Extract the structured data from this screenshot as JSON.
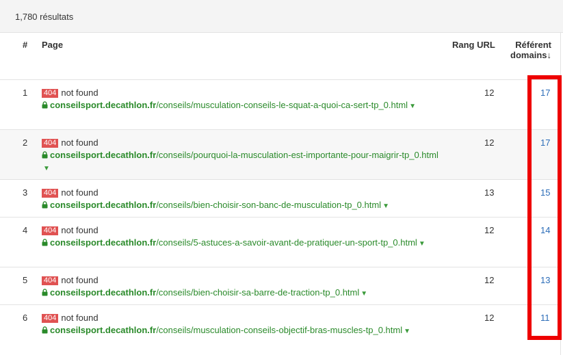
{
  "results": {
    "count_label": "1,780 résultats"
  },
  "table": {
    "headers": {
      "num": "#",
      "page": "Page",
      "rank": "Rang URL",
      "ref_line1": "Référent",
      "ref_line2": "domains",
      "sort_arrow": "↓"
    },
    "rows": [
      {
        "num": "1",
        "status_code": "404",
        "status_text": "not found",
        "domain": "conseilsport.decathlon.fr",
        "path": "/conseils/musculation-conseils-le-squat-a-quoi-ca-sert-tp_0.html",
        "rank": "12",
        "ref": "17"
      },
      {
        "num": "2",
        "status_code": "404",
        "status_text": "not found",
        "domain": "conseilsport.decathlon.fr",
        "path": "/conseils/pourquoi-la-musculation-est-importante-pour-maigrir-tp_0.html",
        "rank": "12",
        "ref": "17"
      },
      {
        "num": "3",
        "status_code": "404",
        "status_text": "not found",
        "domain": "conseilsport.decathlon.fr",
        "path": "/conseils/bien-choisir-son-banc-de-musculation-tp_0.html",
        "rank": "13",
        "ref": "15"
      },
      {
        "num": "4",
        "status_code": "404",
        "status_text": "not found",
        "domain": "conseilsport.decathlon.fr",
        "path": "/conseils/5-astuces-a-savoir-avant-de-pratiquer-un-sport-tp_0.html",
        "rank": "12",
        "ref": "14"
      },
      {
        "num": "5",
        "status_code": "404",
        "status_text": "not found",
        "domain": "conseilsport.decathlon.fr",
        "path": "/conseils/bien-choisir-sa-barre-de-traction-tp_0.html",
        "rank": "12",
        "ref": "13"
      },
      {
        "num": "6",
        "status_code": "404",
        "status_text": "not found",
        "domain": "conseilsport.decathlon.fr",
        "path": "/conseils/musculation-conseils-objectif-bras-muscles-tp_0.html",
        "rank": "12",
        "ref": "11"
      }
    ]
  },
  "icons": {
    "lock": "lock-icon",
    "dropdown": "caret-down-icon"
  },
  "colors": {
    "badge": "#e05252",
    "url_green": "#2a8a2a",
    "ref_blue": "#2b6cb8",
    "highlight": "#ee0000"
  }
}
